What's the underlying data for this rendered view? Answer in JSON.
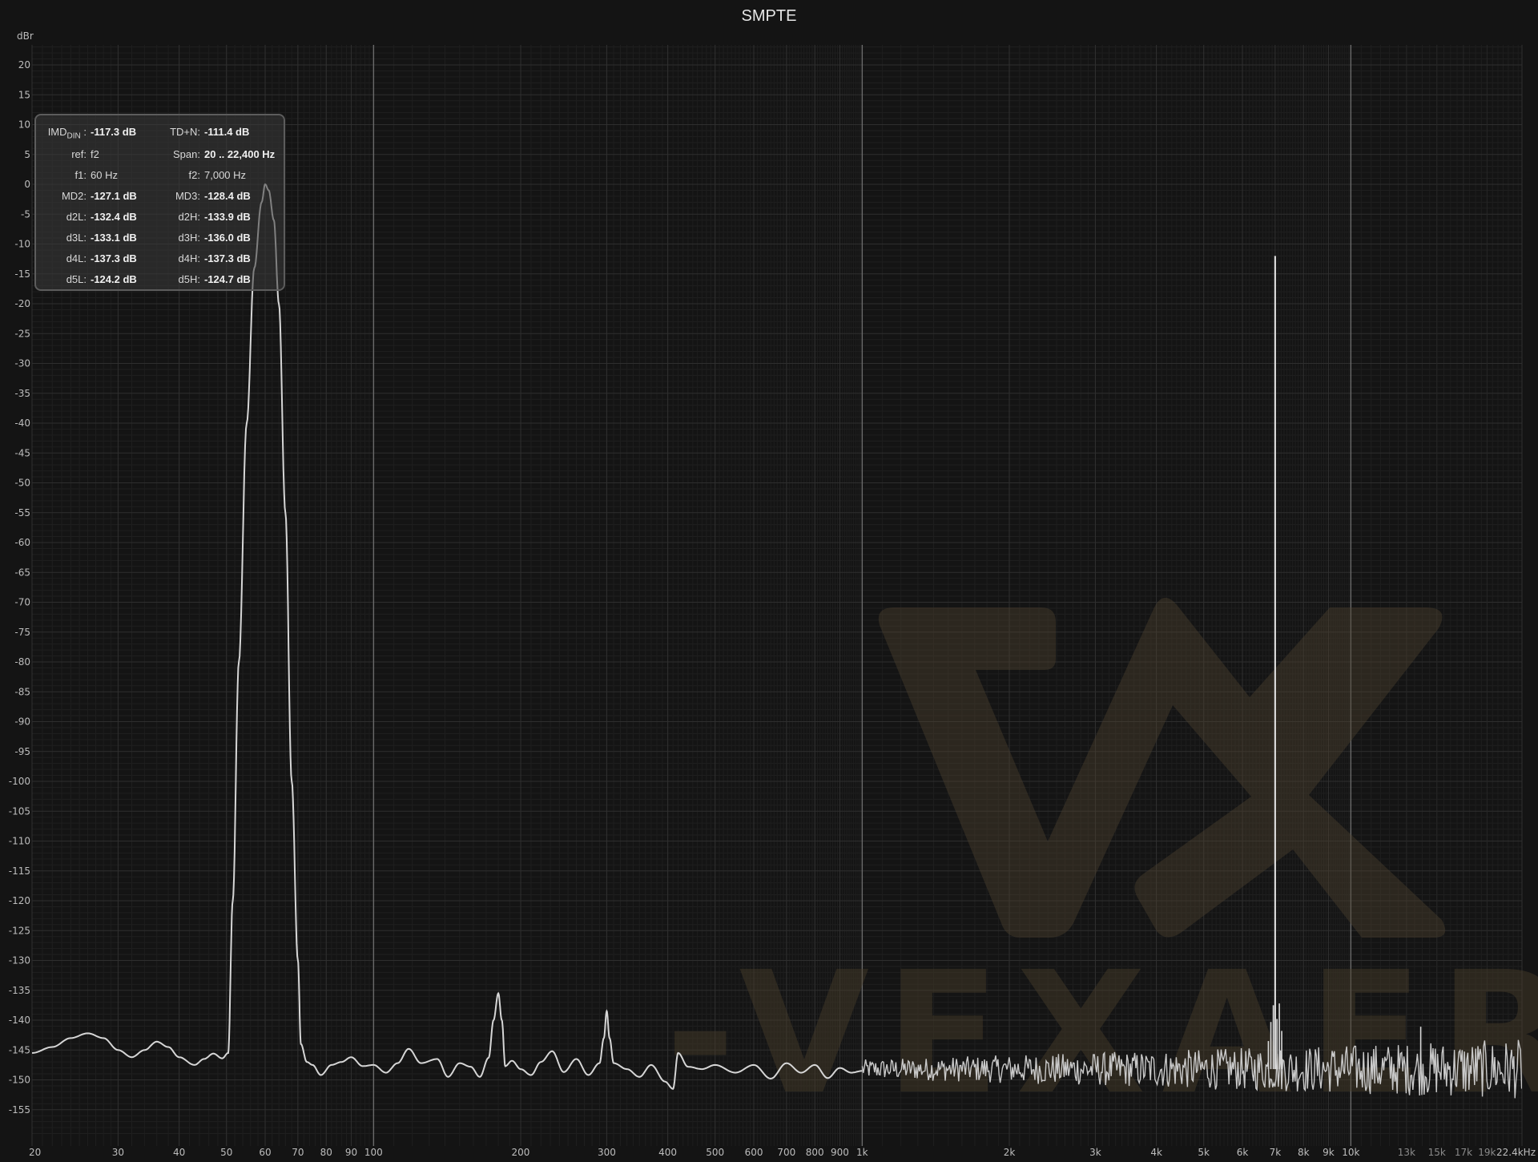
{
  "chart_data": {
    "type": "line",
    "title": "SMPTE",
    "y_unit": "dBr",
    "x_scale": "log",
    "xlim": [
      20,
      22400
    ],
    "ylim": [
      -160,
      25
    ],
    "x_ticks": [
      {
        "v": 20,
        "label": "20"
      },
      {
        "v": 30,
        "label": "30"
      },
      {
        "v": 40,
        "label": "40"
      },
      {
        "v": 50,
        "label": "50"
      },
      {
        "v": 60,
        "label": "60"
      },
      {
        "v": 70,
        "label": "70"
      },
      {
        "v": 80,
        "label": "80"
      },
      {
        "v": 90,
        "label": "90"
      },
      {
        "v": 100,
        "label": "100"
      },
      {
        "v": 200,
        "label": "200"
      },
      {
        "v": 300,
        "label": "300"
      },
      {
        "v": 400,
        "label": "400"
      },
      {
        "v": 500,
        "label": "500"
      },
      {
        "v": 600,
        "label": "600"
      },
      {
        "v": 700,
        "label": "700"
      },
      {
        "v": 800,
        "label": "800"
      },
      {
        "v": 900,
        "label": "900"
      },
      {
        "v": 1000,
        "label": "1k"
      },
      {
        "v": 2000,
        "label": "2k"
      },
      {
        "v": 3000,
        "label": "3k"
      },
      {
        "v": 4000,
        "label": "4k"
      },
      {
        "v": 5000,
        "label": "5k"
      },
      {
        "v": 6000,
        "label": "6k"
      },
      {
        "v": 7000,
        "label": "7k"
      },
      {
        "v": 8000,
        "label": "8k"
      },
      {
        "v": 9000,
        "label": "9k"
      },
      {
        "v": 10000,
        "label": "10k"
      },
      {
        "v": 13000,
        "label": "13k",
        "minor": true
      },
      {
        "v": 15000,
        "label": "15k",
        "minor": true
      },
      {
        "v": 17000,
        "label": "17k",
        "minor": true
      },
      {
        "v": 19000,
        "label": "19k",
        "minor": true
      },
      {
        "v": 22400,
        "label": "22.4kHz"
      }
    ],
    "y_ticks": [
      20,
      15,
      10,
      5,
      0,
      -5,
      -10,
      -15,
      -20,
      -25,
      -30,
      -35,
      -40,
      -45,
      -50,
      -55,
      -60,
      -65,
      -70,
      -75,
      -80,
      -85,
      -90,
      -95,
      -100,
      -105,
      -110,
      -115,
      -120,
      -125,
      -130,
      -135,
      -140,
      -145,
      -150,
      -155
    ],
    "grid": true,
    "series": [
      {
        "color": "#d2d2d2",
        "points": [
          [
            20,
            -145.5
          ],
          [
            22,
            -144.5
          ],
          [
            24,
            -143
          ],
          [
            26,
            -142.2
          ],
          [
            28,
            -143
          ],
          [
            30,
            -145
          ],
          [
            32,
            -146.2
          ],
          [
            34,
            -145
          ],
          [
            36,
            -143.6
          ],
          [
            38,
            -144.5
          ],
          [
            40,
            -146.2
          ],
          [
            43,
            -147.5
          ],
          [
            45,
            -146.5
          ],
          [
            47,
            -145.6
          ],
          [
            49,
            -146.4
          ],
          [
            50.4,
            -145.5
          ],
          [
            51.5,
            -120
          ],
          [
            53,
            -80
          ],
          [
            55,
            -40
          ],
          [
            57,
            -14
          ],
          [
            59,
            -3
          ],
          [
            60,
            0
          ],
          [
            61,
            -1
          ],
          [
            62.5,
            -6
          ],
          [
            64,
            -20
          ],
          [
            66,
            -55
          ],
          [
            68,
            -100
          ],
          [
            70,
            -130
          ],
          [
            71,
            -144
          ],
          [
            73,
            -147
          ],
          [
            75,
            -147.5
          ],
          [
            78,
            -149.2
          ],
          [
            82,
            -147.5
          ],
          [
            86,
            -147
          ],
          [
            90,
            -146.2
          ],
          [
            95,
            -147.7
          ],
          [
            100,
            -147.5
          ],
          [
            106,
            -148.8
          ],
          [
            112,
            -147.2
          ],
          [
            118,
            -144.8
          ],
          [
            125,
            -147.2
          ],
          [
            135,
            -146.5
          ],
          [
            142,
            -149.5
          ],
          [
            150,
            -147.2
          ],
          [
            158,
            -147.8
          ],
          [
            165,
            -149.5
          ],
          [
            172,
            -146.3
          ],
          [
            176,
            -140
          ],
          [
            180,
            -135.5
          ],
          [
            183,
            -140
          ],
          [
            186,
            -147.7
          ],
          [
            192,
            -146.8
          ],
          [
            200,
            -148.2
          ],
          [
            210,
            -149.2
          ],
          [
            220,
            -147
          ],
          [
            232,
            -145.2
          ],
          [
            245,
            -148.7
          ],
          [
            260,
            -146.5
          ],
          [
            275,
            -149.2
          ],
          [
            290,
            -147.2
          ],
          [
            296,
            -143
          ],
          [
            300,
            -138.5
          ],
          [
            304,
            -143
          ],
          [
            310,
            -147.2
          ],
          [
            330,
            -148.2
          ],
          [
            350,
            -149.5
          ],
          [
            370,
            -147.5
          ],
          [
            395,
            -150.3
          ],
          [
            410,
            -151.5
          ],
          [
            420,
            -145.5
          ],
          [
            440,
            -147.8
          ],
          [
            470,
            -148.2
          ],
          [
            500,
            -147.5
          ],
          [
            550,
            -148.8
          ],
          [
            600,
            -147.5
          ],
          [
            650,
            -149.8
          ],
          [
            700,
            -147.2
          ],
          [
            750,
            -148.8
          ],
          [
            800,
            -147.5
          ],
          [
            850,
            -149.7
          ],
          [
            900,
            -148
          ],
          [
            950,
            -148.8
          ],
          [
            1000,
            -148.5
          ]
        ],
        "noise": {
          "from": 1000,
          "to": 22400,
          "baseline": -148.2
        }
      }
    ],
    "spikes": [
      {
        "f": 6860,
        "db": -140.3
      },
      {
        "f": 6940,
        "db": -137.5
      },
      {
        "f": 7000,
        "db": -12
      },
      {
        "f": 7060,
        "db": -139.8
      },
      {
        "f": 7140,
        "db": -137.2
      },
      {
        "f": 7220,
        "db": -141.8
      },
      {
        "f": 6780,
        "db": -143.5
      },
      {
        "f": 13900,
        "db": -141.1
      }
    ]
  },
  "info_panel": {
    "rows": [
      {
        "l_label": "IMD",
        "l_sub": "DIN",
        "l_colon": " :",
        "l_value": "-117.3 dB",
        "l_bold": true,
        "r_label": "TD+N:",
        "r_value": "-111.4 dB",
        "r_bold": true
      },
      {
        "l_label": "ref:",
        "l_value": "f2",
        "l_bold": false,
        "r_label": "Span:",
        "r_value": "20 .. 22,400 Hz",
        "r_bold": true
      },
      {
        "l_label": "f1:",
        "l_value": "60 Hz",
        "l_bold": false,
        "r_label": "f2:",
        "r_value": "7,000 Hz",
        "r_bold": false
      },
      {
        "l_label": "MD2:",
        "l_value": "-127.1 dB",
        "l_bold": true,
        "r_label": "MD3:",
        "r_value": "-128.4 dB",
        "r_bold": true
      },
      {
        "l_label": "d2L:",
        "l_value": "-132.4 dB",
        "l_bold": true,
        "r_label": "d2H:",
        "r_value": "-133.9 dB",
        "r_bold": true
      },
      {
        "l_label": "d3L:",
        "l_value": "-133.1 dB",
        "l_bold": true,
        "r_label": "d3H:",
        "r_value": "-136.0 dB",
        "r_bold": true
      },
      {
        "l_label": "d4L:",
        "l_value": "-137.3 dB",
        "l_bold": true,
        "r_label": "d4H:",
        "r_value": "-137.3 dB",
        "r_bold": true
      },
      {
        "l_label": "d5L:",
        "l_value": "-124.2 dB",
        "l_bold": true,
        "r_label": "d5H:",
        "r_value": "-124.7 dB",
        "r_bold": true
      }
    ]
  },
  "watermark": {
    "text": "-VEXAER-",
    "logo": "vexaer-logo",
    "color": "#6b5a3a"
  }
}
